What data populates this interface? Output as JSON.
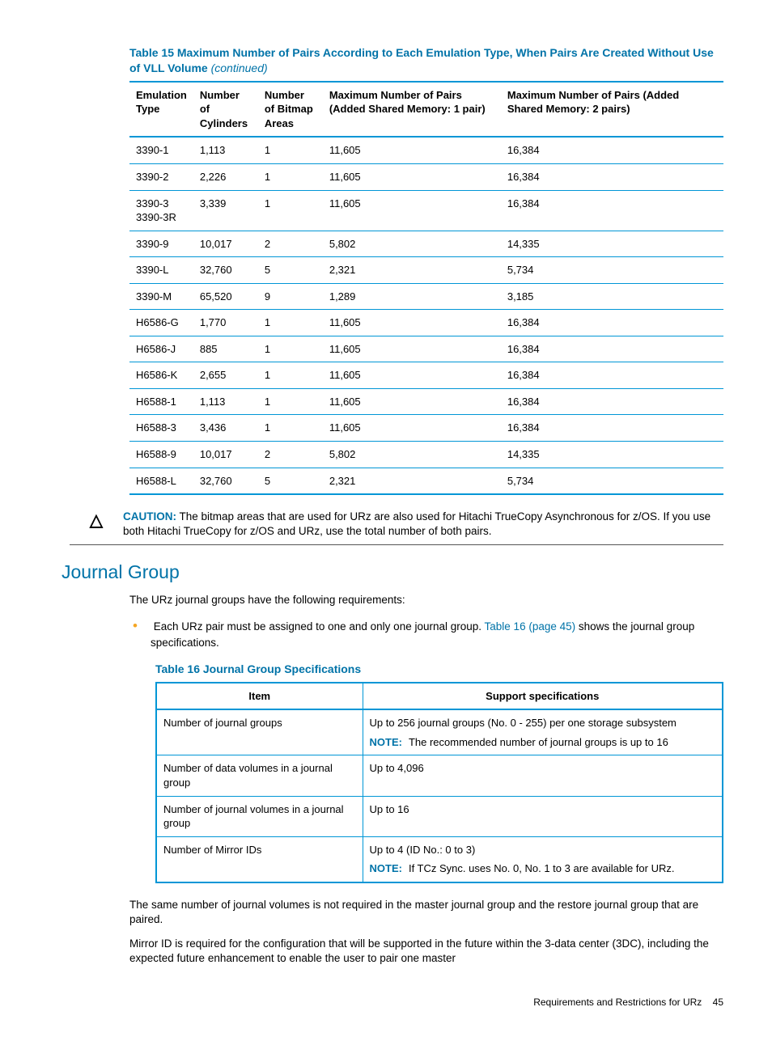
{
  "table15": {
    "caption_main": "Table 15 Maximum Number of Pairs According to Each Emulation Type, When Pairs Are Created Without Use of VLL Volume",
    "caption_cont": "(continued)",
    "headers": {
      "emulation": "Emulation Type",
      "cylinders": "Number of Cylinders",
      "bitmap": "Number of Bitmap Areas",
      "max1": "Maximum Number of Pairs (Added Shared Memory: 1 pair)",
      "max2": "Maximum Number of Pairs (Added Shared Memory: 2 pairs)"
    },
    "rows": [
      {
        "emu": "3390-1",
        "cyl": "1,113",
        "bmp": "1",
        "m1": "11,605",
        "m2": "16,384"
      },
      {
        "emu": "3390-2",
        "cyl": "2,226",
        "bmp": "1",
        "m1": "11,605",
        "m2": "16,384"
      },
      {
        "emu": "3390-3 3390-3R",
        "cyl": "3,339",
        "bmp": "1",
        "m1": "11,605",
        "m2": "16,384"
      },
      {
        "emu": "3390-9",
        "cyl": "10,017",
        "bmp": "2",
        "m1": "5,802",
        "m2": "14,335"
      },
      {
        "emu": "3390-L",
        "cyl": "32,760",
        "bmp": "5",
        "m1": "2,321",
        "m2": "5,734"
      },
      {
        "emu": "3390-M",
        "cyl": "65,520",
        "bmp": "9",
        "m1": "1,289",
        "m2": "3,185"
      },
      {
        "emu": "H6586-G",
        "cyl": "1,770",
        "bmp": "1",
        "m1": "11,605",
        "m2": "16,384"
      },
      {
        "emu": "H6586-J",
        "cyl": "885",
        "bmp": "1",
        "m1": "11,605",
        "m2": "16,384"
      },
      {
        "emu": "H6586-K",
        "cyl": "2,655",
        "bmp": "1",
        "m1": "11,605",
        "m2": "16,384"
      },
      {
        "emu": "H6588-1",
        "cyl": "1,113",
        "bmp": "1",
        "m1": "11,605",
        "m2": "16,384"
      },
      {
        "emu": "H6588-3",
        "cyl": "3,436",
        "bmp": "1",
        "m1": "11,605",
        "m2": "16,384"
      },
      {
        "emu": "H6588-9",
        "cyl": "10,017",
        "bmp": "2",
        "m1": "5,802",
        "m2": "14,335"
      },
      {
        "emu": "H6588-L",
        "cyl": "32,760",
        "bmp": "5",
        "m1": "2,321",
        "m2": "5,734"
      }
    ]
  },
  "caution": {
    "label": "CAUTION:",
    "text": "The bitmap areas that are used for URz are also used for Hitachi TrueCopy Asynchronous for z/OS. If you use both Hitachi TrueCopy for z/OS and URz, use the total number of both pairs."
  },
  "section_heading": "Journal Group",
  "intro_para": "The URz journal groups have the following requirements:",
  "bullet": {
    "pre": "Each URz pair must be assigned to one and only one journal group. ",
    "link": "Table 16 (page 45)",
    "post": " shows the journal group specifications."
  },
  "table16": {
    "caption": "Table 16 Journal Group Specifications",
    "headers": {
      "item": "Item",
      "spec": "Support specifications"
    },
    "rows": [
      {
        "item": "Number of journal groups",
        "spec": "Up to 256 journal groups (No. 0 - 255) per one storage subsystem",
        "note_label": "NOTE:",
        "note": "The recommended number of journal groups is up to 16"
      },
      {
        "item": "Number of data volumes in a journal group",
        "spec": "Up to 4,096"
      },
      {
        "item": "Number of journal volumes in a journal group",
        "spec": "Up to 16"
      },
      {
        "item": "Number of Mirror IDs",
        "spec": "Up to 4 (ID No.: 0 to 3)",
        "note_label": "NOTE:",
        "note": "If TCz Sync. uses No. 0, No. 1 to 3 are available for URz."
      }
    ]
  },
  "para_after_1": "The same number of journal volumes is not required in the master journal group and the restore journal group that are paired.",
  "para_after_2": "Mirror ID is required for the configuration that will be supported in the future within the 3-data center (3DC), including the expected future enhancement to enable the user to pair one master",
  "footer": {
    "text": "Requirements and Restrictions for URz",
    "page": "45"
  }
}
